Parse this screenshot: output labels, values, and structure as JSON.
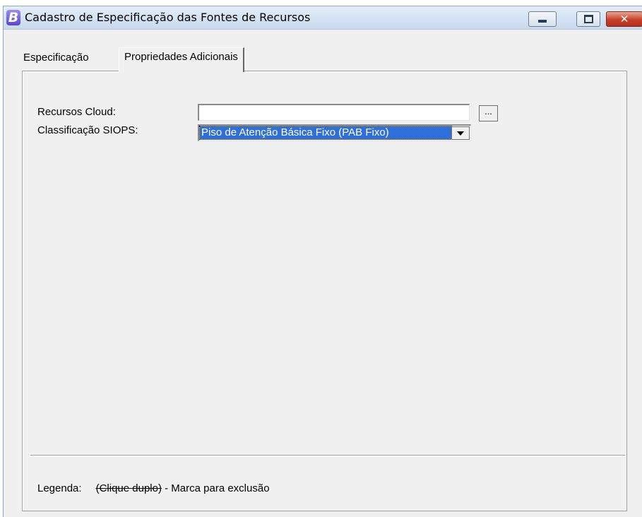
{
  "window": {
    "title": "Cadastro de Especificação das Fontes de Recursos",
    "icon_letter": "B",
    "controls": {
      "minimize": "minimize-icon",
      "maximize": "maximize-icon",
      "close": "close-icon",
      "close_glyph": "✕"
    }
  },
  "tabs": [
    {
      "label": "Especificação",
      "active": false
    },
    {
      "label": "Propriedades Adicionais",
      "active": true
    }
  ],
  "form": {
    "recursos_cloud": {
      "label": "Recursos Cloud:",
      "value": "",
      "browse_label": "..."
    },
    "classificacao_siops": {
      "label": "Classificação SIOPS:",
      "selected": "Piso de Atenção Básica Fixo (PAB Fixo)"
    }
  },
  "legend": {
    "label": "Legenda:",
    "strike_text": "(Clique duplo)",
    "description": " - Marca para exclusão"
  },
  "colors": {
    "selection": "#2e6fd9",
    "window_bg": "#f0f0f0",
    "close_button": "#c7402a"
  }
}
